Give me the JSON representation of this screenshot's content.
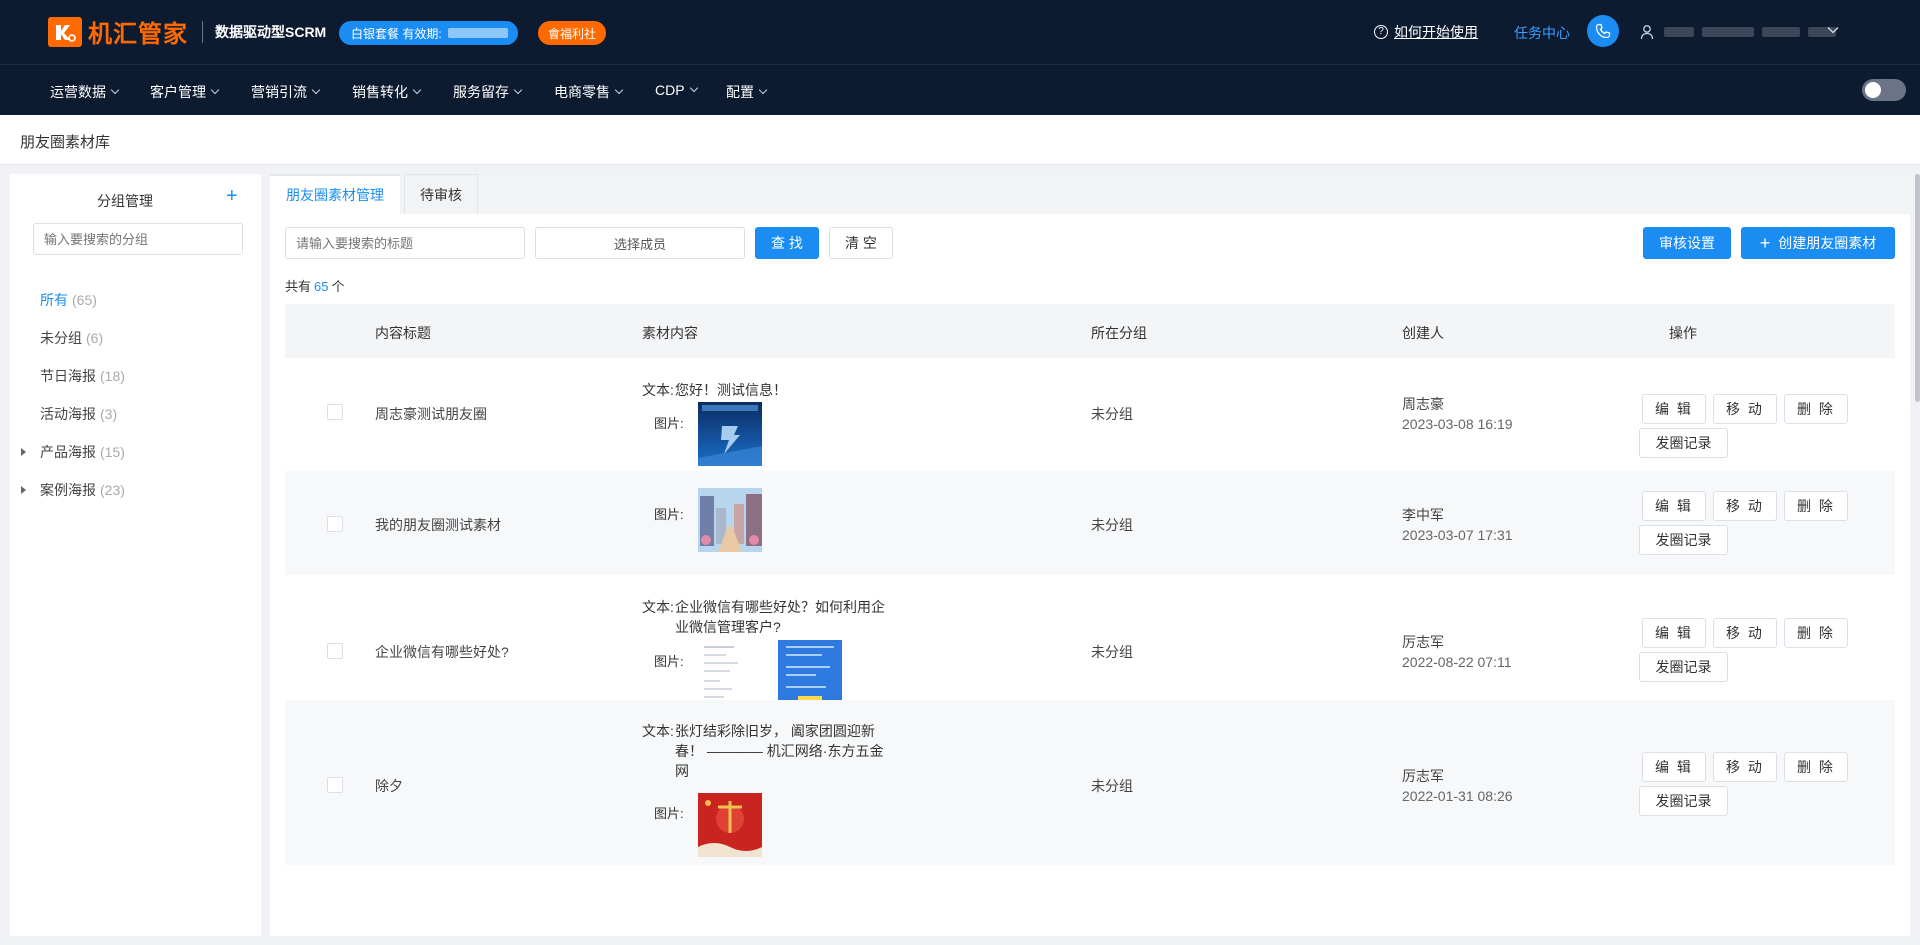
{
  "brand": {
    "logo_text": "机汇管家",
    "tagline": "数据驱动型SCRM"
  },
  "header": {
    "plan_label": "白银套餐 有效期:",
    "welfare_label": "會福利社",
    "help_label": "如何开始使用",
    "task_center": "任务中心"
  },
  "nav": {
    "items": [
      {
        "label": "运营数据"
      },
      {
        "label": "客户管理"
      },
      {
        "label": "营销引流"
      },
      {
        "label": "销售转化"
      },
      {
        "label": "服务留存"
      },
      {
        "label": "电商零售"
      },
      {
        "label": "CDP"
      },
      {
        "label": "配置"
      }
    ]
  },
  "breadcrumb": "朋友圈素材库",
  "groups": {
    "title": "分组管理",
    "add_icon": "+",
    "search_placeholder": "输入要搜索的分组",
    "items": [
      {
        "label": "所有",
        "count": "(65)"
      },
      {
        "label": "未分组",
        "count": "(6)"
      },
      {
        "label": "节日海报",
        "count": "(18)"
      },
      {
        "label": "活动海报",
        "count": "(3)"
      },
      {
        "label": "产品海报",
        "count": "(15)"
      },
      {
        "label": "案例海报",
        "count": "(23)"
      }
    ]
  },
  "tabs": [
    {
      "label": "朋友圈素材管理"
    },
    {
      "label": "待审核"
    }
  ],
  "filters": {
    "title_placeholder": "请输入要搜索的标题",
    "member_select": "选择成员",
    "search_button": "查 找",
    "clear_button": "清 空",
    "review_settings": "审核设置",
    "create_button": "创建朋友圈素材",
    "create_icon": "+"
  },
  "total": {
    "prefix": "共有",
    "count": "65",
    "suffix": "个"
  },
  "table": {
    "headers": {
      "title": "内容标题",
      "content": "素材内容",
      "group": "所在分组",
      "creator": "创建人",
      "actions": "操作"
    },
    "text_label": "文本:",
    "image_label": "图片:",
    "action_labels": {
      "edit": "编 辑",
      "move": "移 动",
      "delete": "删 除",
      "history": "发圈记录"
    },
    "rows": [
      {
        "title": "周志豪测试朋友圈",
        "text": "您好！测试信息！",
        "group": "未分组",
        "creator": "周志豪",
        "created": "2023-03-08 16:19"
      },
      {
        "title": "我的朋友圈测试素材",
        "text": "",
        "group": "未分组",
        "creator": "李中军",
        "created": "2023-03-07 17:31"
      },
      {
        "title": "企业微信有哪些好处?",
        "text": "企业微信有哪些好处？如何利用企业微信管理客户?",
        "group": "未分组",
        "creator": "厉志军",
        "created": "2022-08-22 07:11"
      },
      {
        "title": "除夕",
        "text": "张灯结彩除旧岁， 阖家团圆迎新春！ ———— 机汇网络·东方五金网",
        "group": "未分组",
        "creator": "厉志军",
        "created": "2022-01-31 08:26"
      }
    ]
  },
  "colors": {
    "accent": "#1b8df2",
    "brand_orange": "#ff6a00",
    "header_bg": "#0d1b31"
  },
  "icons": [
    "help-icon",
    "phone-icon",
    "user-icon",
    "chevron-down-icon",
    "plus-icon",
    "caret-right-icon"
  ]
}
